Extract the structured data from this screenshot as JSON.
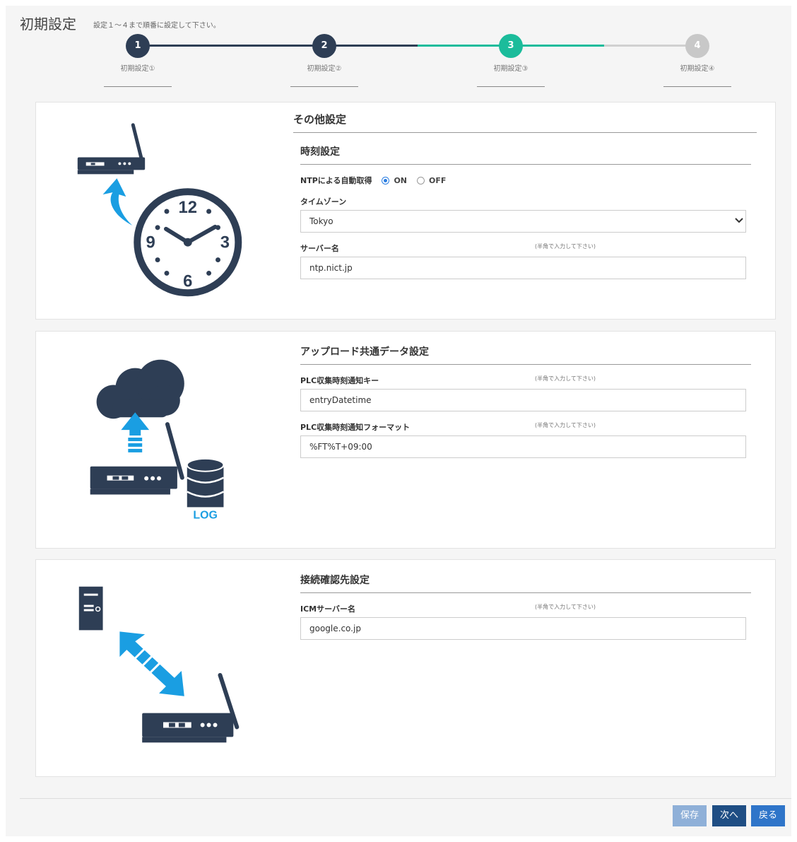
{
  "header": {
    "title": "初期設定",
    "subtitle": "設定１～４まで順番に設定して下さい。"
  },
  "steps": [
    {
      "number": "1",
      "label": "初期設定①",
      "state": "done"
    },
    {
      "number": "2",
      "label": "初期設定②",
      "state": "done"
    },
    {
      "number": "3",
      "label": "初期設定③",
      "state": "current"
    },
    {
      "number": "4",
      "label": "初期設定④",
      "state": "pending"
    }
  ],
  "colors": {
    "done": "#2e3e55",
    "current": "#1bbc9b",
    "pending": "#c8c8c8",
    "icon_dark": "#2e3e55",
    "icon_blue": "#1a9ee2"
  },
  "time_card": {
    "section_title": "その他設定",
    "sub_title": "時刻設定",
    "ntp_label": "NTPによる自動取得",
    "ntp_on": "ON",
    "ntp_off": "OFF",
    "ntp_selected": "ON",
    "timezone_label": "タイムゾーン",
    "timezone_value": "Tokyo",
    "server_label": "サーバー名",
    "server_hint": "(半角で入力して下さい)",
    "server_value": "ntp.nict.jp",
    "clock_numbers": [
      "12",
      "3",
      "6",
      "9"
    ]
  },
  "upload_card": {
    "title": "アップロード共通データ設定",
    "key_label": "PLC収集時刻通知キー",
    "key_hint": "(半角で入力して下さい)",
    "key_value": "entryDatetime",
    "format_label": "PLC収集時刻通知フォーマット",
    "format_hint": "(半角で入力して下さい)",
    "format_value": "%FT%T+09:00",
    "log_text": "LOG"
  },
  "connect_card": {
    "title": "接続確認先設定",
    "icm_label": "ICMサーバー名",
    "icm_hint": "(半角で入力して下さい)",
    "icm_value": "google.co.jp"
  },
  "footer": {
    "save": "保存",
    "next": "次へ",
    "back": "戻る"
  }
}
